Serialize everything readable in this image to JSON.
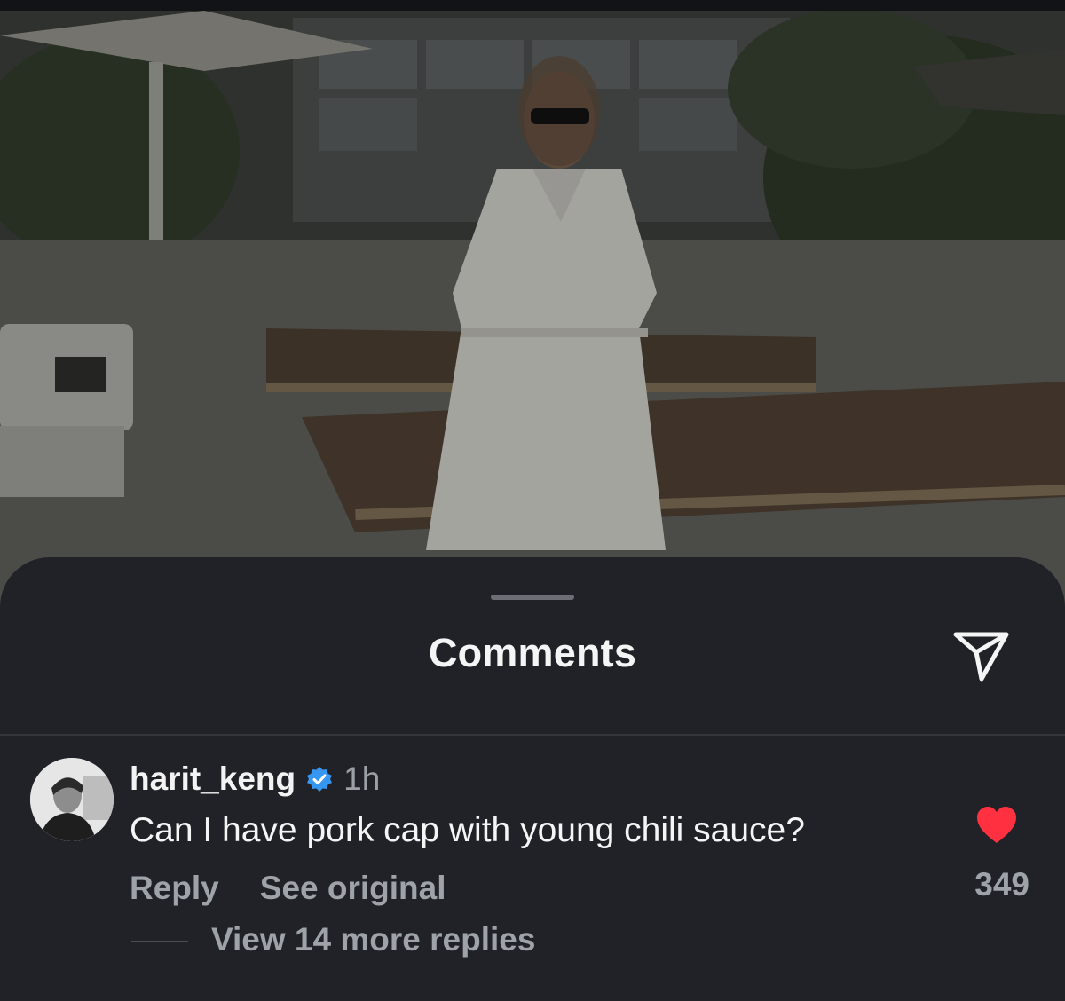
{
  "sheet": {
    "title": "Comments",
    "share_icon": "paper-plane-icon"
  },
  "comment": {
    "username": "harit_keng",
    "verified_icon": "verified-badge-icon",
    "verified_color": "#3797f0",
    "time": "1h",
    "text": "Can I have pork cap with young chili sauce?",
    "reply_label": "Reply",
    "see_original_label": "See original",
    "like_icon": "heart-icon",
    "like_color": "#ff3040",
    "liked": true,
    "like_count": "349",
    "view_replies_label": "View 14 more replies"
  }
}
